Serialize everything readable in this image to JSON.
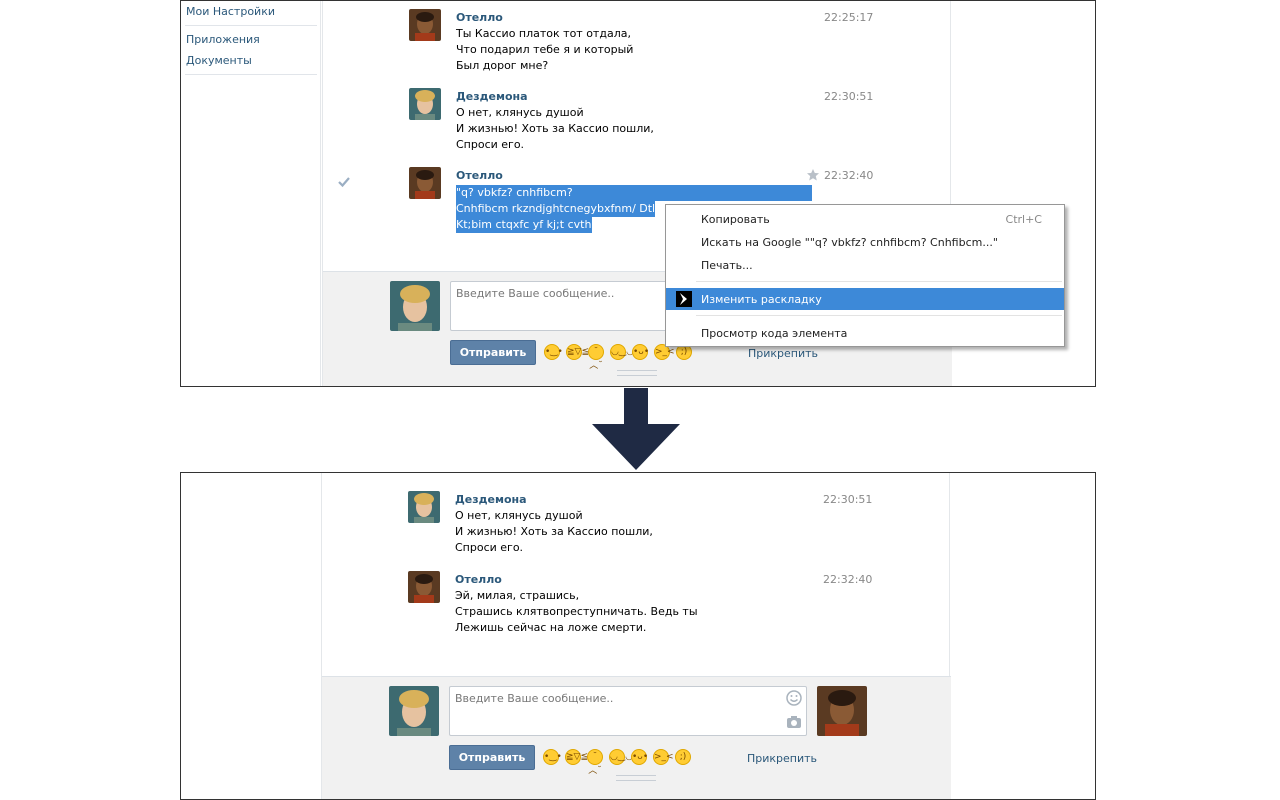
{
  "sidebar": {
    "items": [
      "Мои Настройки",
      "Приложения",
      "Документы"
    ]
  },
  "top": {
    "messages": [
      {
        "author": "Отелло",
        "time": "22:25:17",
        "lines": [
          "Ты Кассио платок тот отдала,",
          "Что подарил тебе я и который",
          "Был дорог мне?"
        ]
      },
      {
        "author": "Дездемона",
        "time": "22:30:51",
        "lines": [
          "О нет, клянусь душой",
          "И жизнью! Хоть за Кассио пошли,",
          "Спроси его."
        ]
      },
      {
        "author": "Отелло",
        "time": "22:32:40",
        "lines": [
          "\"q? vbkfz? cnhfibcm?",
          "Cnhfibcm rkzndjghtcnegybxfnm/ Dtlm ns",
          "Kt;bim ctqxfc yf kj;t cvthnb/"
        ]
      }
    ],
    "input_placeholder": "Введите Ваше сообщение..",
    "send_label": "Отправить",
    "attach_label": "Прикрепить"
  },
  "context_menu": {
    "items": [
      {
        "label": "Копировать",
        "shortcut": "Ctrl+C"
      },
      {
        "label": "Искать на Google \"\"q? vbkfz? cnhfibcm? Cnhfibcm...\"",
        "shortcut": ""
      },
      {
        "label": "Печать...",
        "shortcut": ""
      },
      {
        "label": "Изменить раскладку",
        "shortcut": ""
      },
      {
        "label": "Просмотр кода элемента",
        "shortcut": ""
      }
    ]
  },
  "bottom": {
    "messages": [
      {
        "author": "Дездемона",
        "time": "22:30:51",
        "lines": [
          "О нет, клянусь душой",
          "И жизнью! Хоть за Кассио пошли,",
          "Спроси его."
        ]
      },
      {
        "author": "Отелло",
        "time": "22:32:40",
        "lines": [
          "Эй, милая, страшись,",
          "Страшись клятвопреступничать. Ведь ты",
          "Лежишь сейчас на ложе смерти."
        ]
      }
    ],
    "input_placeholder": "Введите Ваше сообщение..",
    "send_label": "Отправить",
    "attach_label": "Прикрепить"
  },
  "icons": {
    "check": "check-icon",
    "star": "star-icon",
    "smiley": "smiley-icon",
    "camera": "camera-icon",
    "arrow": "down-arrow-icon",
    "layout_switch": "layout-switch-icon"
  },
  "colors": {
    "link": "#2b587a",
    "selection": "#3d89d8",
    "button": "#5e82a8",
    "arrow": "#1f2a44"
  }
}
